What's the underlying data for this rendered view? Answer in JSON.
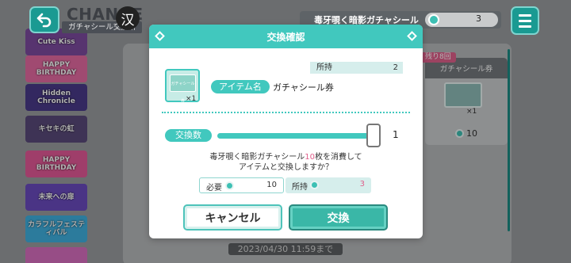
{
  "header": {
    "title": "CHANGE",
    "subtitle": "ガチャシール交換所",
    "ime_indicator": "汉",
    "currency_label": "毒牙覗く暗影ガチャシール",
    "currency_count": "3"
  },
  "sidebar": {
    "items": [
      {
        "label": "Cute Kiss"
      },
      {
        "label": "HAPPY BIRTHDAY"
      },
      {
        "label": "Hidden Chronicle"
      },
      {
        "label": "キセキの虹"
      },
      {
        "label": "HAPPY BIRTHDAY"
      },
      {
        "label": "未来への扉"
      },
      {
        "label": "カラフルフェスティバル"
      },
      {
        "label": ""
      }
    ]
  },
  "card": {
    "badge": "残り8回",
    "title": "ガチャシール券",
    "qty": "×1",
    "cost": "10"
  },
  "footer": {
    "date": "2023/04/30 11:59まで"
  },
  "dialog": {
    "title": "交換確認",
    "owned_label": "所持",
    "owned_value": "2",
    "item_name_label": "アイテム名",
    "item_name": "ガチャシール券",
    "item_qty": "×1",
    "ticket_text": "ガチャシール券",
    "qty_label": "交換数",
    "qty_value": "1",
    "slider_fraction": 1.0,
    "message_line1_a": "毒牙覗く暗影ガチャシール",
    "message_line1_num": "10",
    "message_line1_b": "枚を消費して",
    "message_line2": "アイテムと交換しますか？",
    "need_label": "必要",
    "need_value": "10",
    "have_label": "所持",
    "have_value": "3",
    "cancel_label": "キャンセル",
    "ok_label": "交換"
  },
  "colors": {
    "accent": "#41c8be",
    "highlight_pink": "#e0608c",
    "button_ok": "#3ab7a7"
  }
}
